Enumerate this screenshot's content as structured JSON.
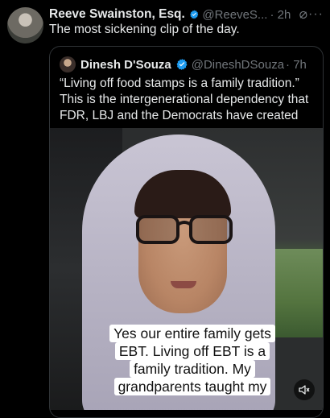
{
  "tweet": {
    "author_name": "Reeve Swainston, Esq.",
    "handle": "@ReeveS...",
    "time": "· 2h",
    "more": "···",
    "text": "The most sickening clip of the day."
  },
  "quote": {
    "author_name": "Dinesh D'Souza",
    "handle": "@DineshDSouza",
    "time": "· 7h",
    "text_lines": [
      "“Living off food stamps is a family tradition.”",
      "This is the intergenerational dependency that",
      "FDR, LBJ and the Democrats have created"
    ]
  },
  "video": {
    "caption_lines": [
      "Yes our entire family gets",
      "EBT. Living off EBT is a",
      "family tradition. My",
      "grandparents taught my"
    ],
    "audio_state": "muted"
  },
  "colors": {
    "background": "#000000",
    "text": "#e7e9ea",
    "secondary": "#71767b",
    "verified": "#1d9bf0",
    "border": "#2f3336"
  },
  "icons": [
    "verified-badge-icon",
    "grok-icon",
    "more-icon",
    "speaker-muted-icon"
  ]
}
